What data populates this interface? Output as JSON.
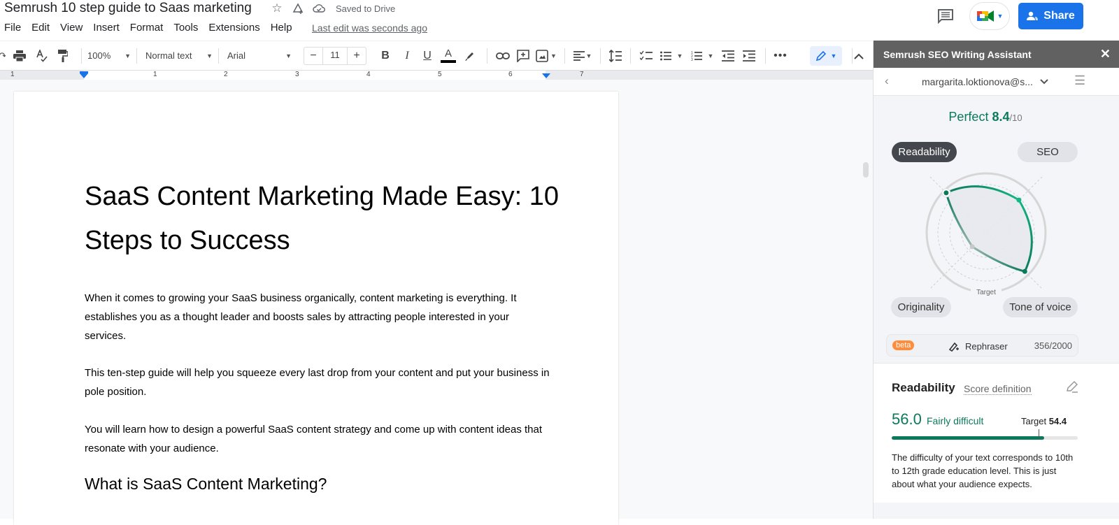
{
  "doc": {
    "title": "Semrush 10 step guide to Saas marketing",
    "saved_status": "Saved to Drive",
    "last_edit": "Last edit was seconds ago"
  },
  "menu": [
    "File",
    "Edit",
    "View",
    "Insert",
    "Format",
    "Tools",
    "Extensions",
    "Help"
  ],
  "header": {
    "share_label": "Share"
  },
  "toolbar": {
    "zoom": "100%",
    "style": "Normal text",
    "font": "Arial",
    "font_size": "11",
    "minus": "−",
    "plus": "+"
  },
  "ruler": {
    "labels": [
      "1",
      "1",
      "2",
      "3",
      "4",
      "5",
      "6",
      "7"
    ]
  },
  "content": {
    "title": "SaaS Content Marketing Made Easy: 10 Steps to Success",
    "paragraphs": [
      "When it comes to growing your SaaS business organically, content marketing is everything. It establishes you as a thought leader and boosts sales by attracting people interested in your services.",
      "This ten-step guide will help you squeeze every last drop from your content and put your business in pole position.",
      "You will learn how to design a powerful SaaS content strategy and come up with content ideas that resonate with your audience."
    ],
    "heading2": "What is SaaS Content Marketing?"
  },
  "panel": {
    "title": "Semrush SEO Writing Assistant",
    "account": "margarita.loktionova@s...",
    "score_label": "Perfect",
    "score_value": "8.4",
    "score_max": "/10",
    "tabs": {
      "readability": "Readability",
      "seo": "SEO",
      "originality": "Originality",
      "tone": "Tone of voice"
    },
    "radar_target_label": "Target",
    "radar_values": {
      "readability": 0.95,
      "seo": 0.78,
      "tone_of_voice": 0.92,
      "originality": 0.33
    },
    "rephraser": {
      "badge": "beta",
      "label": "Rephraser",
      "count": "356/2000"
    },
    "readability": {
      "title": "Readability",
      "score_definition": "Score definition",
      "score": "56.0",
      "score_label": "Fairly difficult",
      "target_prefix": "Target",
      "target": "54.4",
      "progress": 0.82,
      "target_position": 0.79,
      "description": "The difficulty of your text corresponds to 10th to 12th grade education level. This is just about what your audience expects."
    }
  },
  "colors": {
    "accent_green": "#0b7a5b",
    "share_blue": "#1a73e8",
    "beta_orange": "#ff8c3a",
    "panel_header": "#616161"
  }
}
